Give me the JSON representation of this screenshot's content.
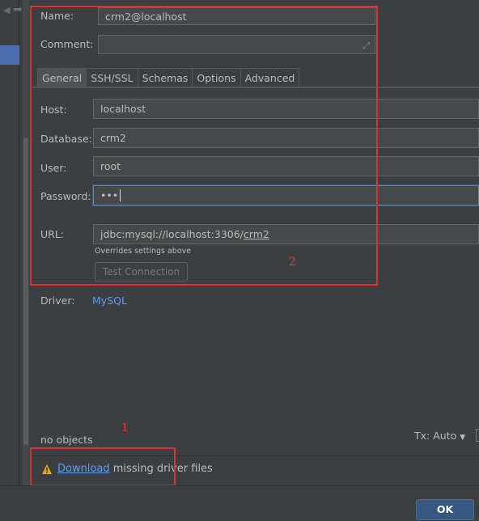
{
  "form": {
    "name_label": "Name:",
    "name_value": "crm2@localhost",
    "comment_label": "Comment:",
    "comment_value": ""
  },
  "tabs": [
    {
      "label": "General",
      "active": true
    },
    {
      "label": "SSH/SSL"
    },
    {
      "label": "Schemas"
    },
    {
      "label": "Options"
    },
    {
      "label": "Advanced"
    }
  ],
  "general": {
    "host_label": "Host:",
    "host_value": "localhost",
    "database_label": "Database:",
    "database_value": "crm2",
    "user_label": "User:",
    "user_value": "root",
    "password_label": "Password:",
    "password_value": "•••",
    "url_label": "URL:",
    "url_prefix": "jdbc:mysql://localhost:3306/",
    "url_db": "crm2",
    "url_hint": "Overrides settings above",
    "test_connection_label": "Test Connection",
    "driver_label": "Driver:",
    "driver_value": "MySQL"
  },
  "status": {
    "objects": "no objects",
    "tx_label": "Tx: Auto"
  },
  "warning": {
    "link": "Download",
    "text": "missing driver files"
  },
  "annotations": {
    "box1_number": "1",
    "box2_number": "2"
  },
  "footer": {
    "ok_label": "OK"
  },
  "colors": {
    "background": "#3c3f41",
    "field": "#45494a",
    "link": "#589df6",
    "annotation": "#e0302f",
    "ok_button": "#365880"
  }
}
